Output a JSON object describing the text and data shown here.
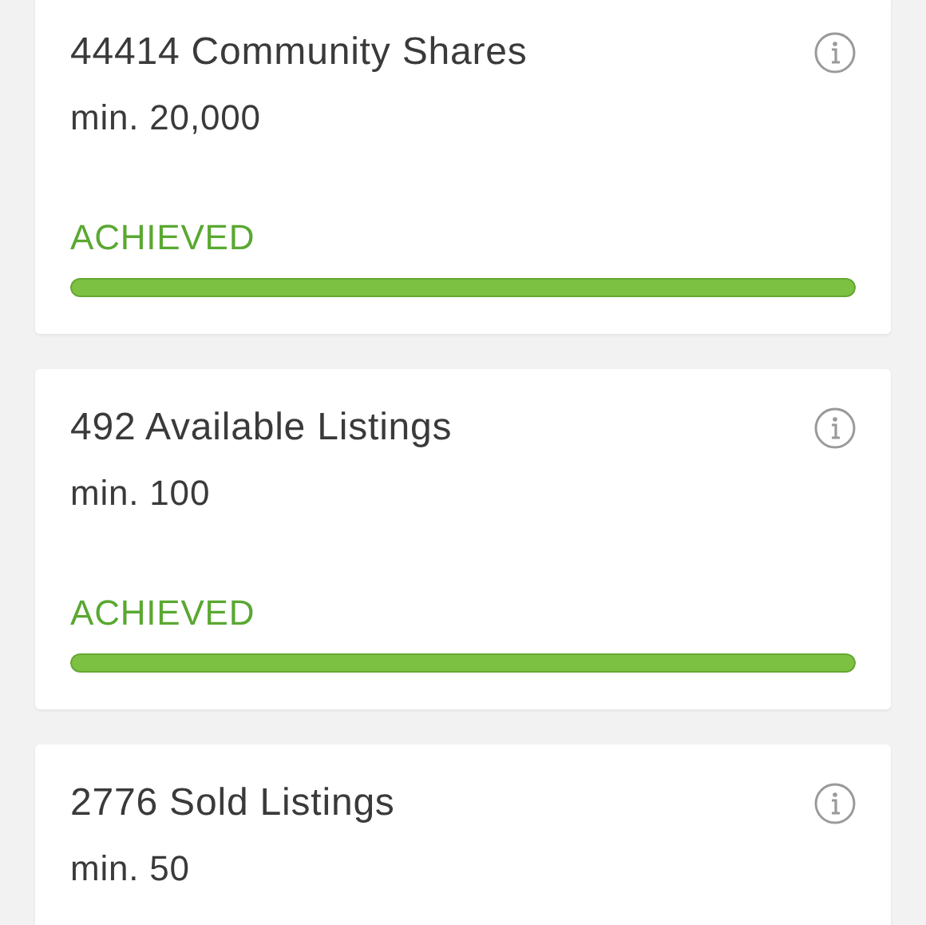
{
  "goals": [
    {
      "title": "44414 Community Shares",
      "minimum": "min. 20,000",
      "status": "ACHIEVED",
      "level": 1
    },
    {
      "title": "492 Available Listings",
      "minimum": "min. 100",
      "status": "ACHIEVED",
      "level": 1
    },
    {
      "title": "2776 Sold Listings",
      "minimum": "min. 50"
    }
  ]
}
